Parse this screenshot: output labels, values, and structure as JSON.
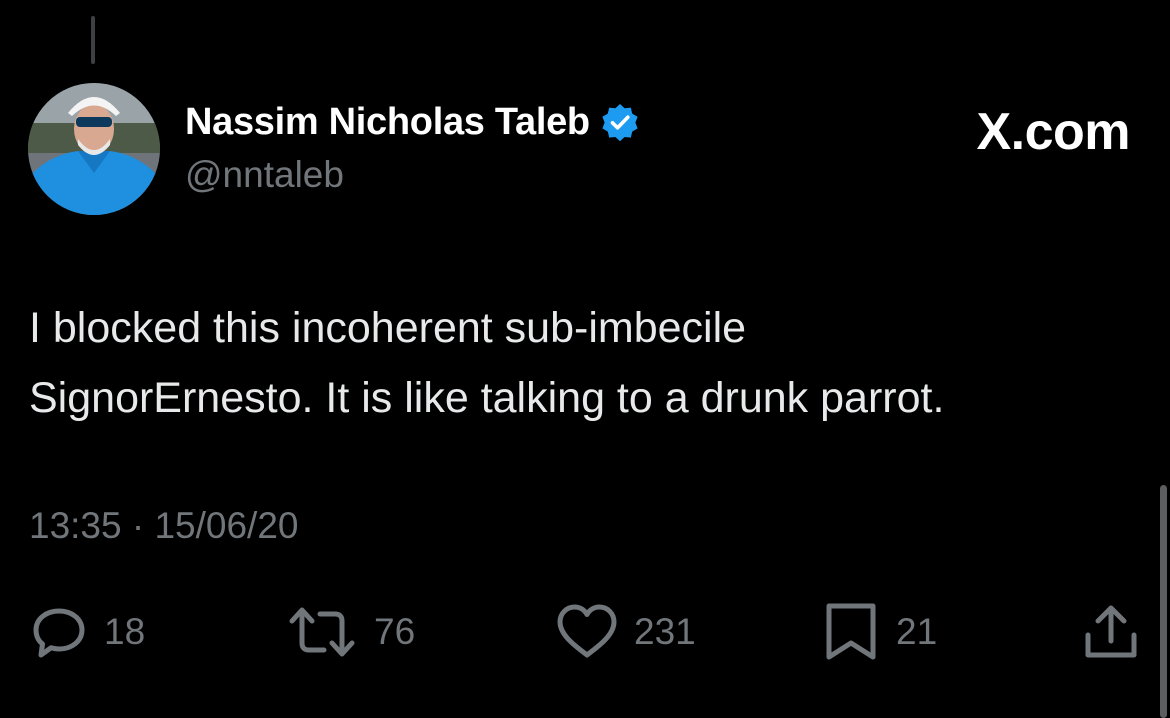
{
  "tweet": {
    "author": {
      "display_name": "Nassim Nicholas Taleb",
      "handle": "@nntaleb",
      "verified": true
    },
    "brand": "X.com",
    "text_lines": [
      "I blocked this incoherent sub-imbecile",
      "SignorErnesto. It is like talking to a drunk parrot."
    ],
    "timestamp": "13:35 · 15/06/20"
  },
  "actions": {
    "replies": {
      "icon": "reply-icon",
      "count": "18"
    },
    "reposts": {
      "icon": "repost-icon",
      "count": "76"
    },
    "likes": {
      "icon": "heart-icon",
      "count": "231"
    },
    "bookmarks": {
      "icon": "bookmark-icon",
      "count": "21"
    },
    "share": {
      "icon": "share-icon"
    }
  },
  "colors": {
    "background": "#000000",
    "text_primary": "#e7e9ea",
    "text_secondary": "#71767b",
    "verified_blue": "#1d9bf0"
  }
}
